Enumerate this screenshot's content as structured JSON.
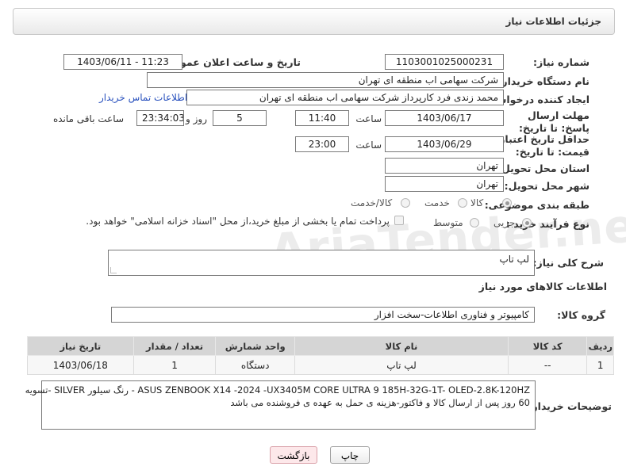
{
  "header": {
    "title": "جزئیات اطلاعات نیاز"
  },
  "fields": {
    "need_number_label": "شماره نیاز:",
    "need_number": "1103001025000231",
    "announce_label": "تاریخ و ساعت اعلان عمومی:",
    "announce_value": "1403/06/11 - 11:23",
    "buyer_label": "نام دستگاه خریدار:",
    "buyer_value": "شرکت سهامی اب منطقه ای تهران",
    "creator_label": "ایجاد کننده درخواست:",
    "creator_value": "محمد زندی فرد کارپرداز شرکت سهامی اب منطقه ای تهران",
    "contact_link": "اطلاعات تماس خریدار",
    "deadline_label": "مهلت ارسال پاسخ: تا تاریخ:",
    "deadline_date": "1403/06/17",
    "time_label": "ساعت",
    "deadline_time": "11:40",
    "days_value": "5",
    "days_label": "روز و",
    "remaining_time": "23:34:03",
    "remaining_label": "ساعت باقی مانده",
    "validity_label": "حداقل تاریخ اعتبار قیمت: تا تاریخ:",
    "validity_date": "1403/06/29",
    "validity_time_label": "ساعت",
    "validity_time": "23:00",
    "province_label": "استان محل تحویل:",
    "province_value": "تهران",
    "city_label": "شهر محل تحویل:",
    "city_value": "تهران",
    "category_label": "طبقه بندی موضوعی:",
    "category_options": [
      "کالا",
      "خدمت",
      "کالا/خدمت"
    ],
    "process_label": "نوع فرآیند خرید :",
    "process_options": [
      "جزیی",
      "متوسط"
    ],
    "process_note": "پرداخت تمام یا بخشی از مبلغ خرید،از محل \"اسناد خزانه اسلامی\" خواهد بود."
  },
  "summary": {
    "label": "شرح کلی نیاز:",
    "value": "لپ تاپ"
  },
  "goods_section": {
    "title": "اطلاعات کالاهای مورد نیاز",
    "group_label": "گروه کالا:",
    "group_value": "کامپیوتر و فناوری اطلاعات-سخت افزار"
  },
  "table": {
    "headers": [
      "ردیف",
      "کد کالا",
      "نام کالا",
      "واحد شمارش",
      "تعداد / مقدار",
      "تاریخ نیاز"
    ],
    "rows": [
      [
        "1",
        "--",
        "لپ تاپ",
        "دستگاه",
        "1",
        "1403/06/18"
      ]
    ]
  },
  "buyer_notes": {
    "label": "توضیحات خریدار:",
    "line1": "ASUS ZENBOOK X14 -2024 -UX3405M CORE ULTRA 9 185H-32G-1T- OLED-2.8K-120HZ  - رنگ سیلور SILVER -تسویه",
    "line2": "60 روز پس از ارسال کالا و فاکتور-هزینه ی حمل به عهده ی فروشنده می باشد"
  },
  "buttons": {
    "print": "چاپ",
    "back": "بازگشت"
  },
  "watermark": "AriaTender.neT",
  "colors": {
    "link": "#2a52be",
    "header_bg": "#d5d5d5",
    "back_btn_bg": "#fde8ea"
  }
}
